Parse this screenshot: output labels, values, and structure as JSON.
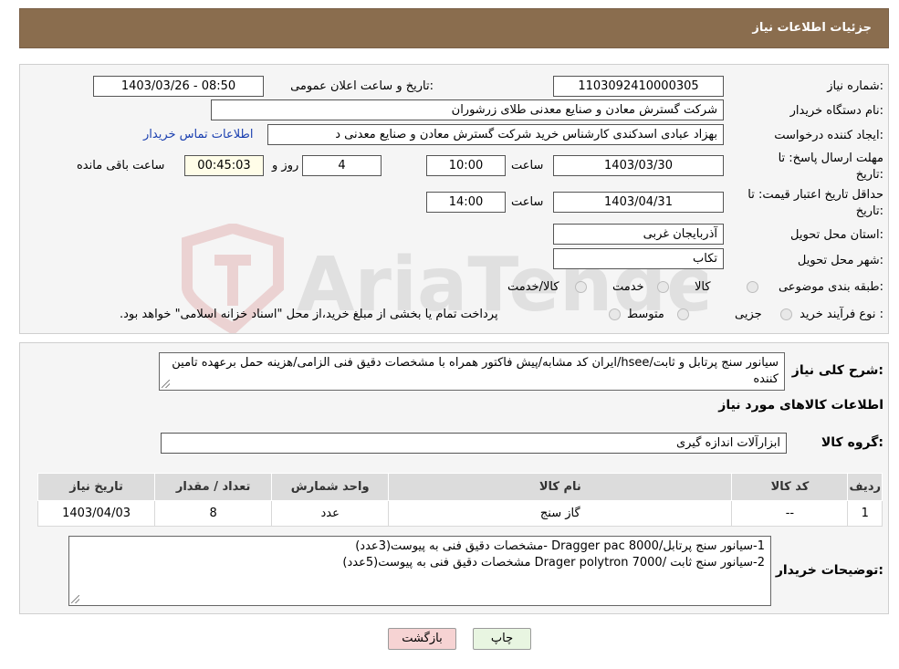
{
  "header": {
    "title": "جزئیات اطلاعات نیاز"
  },
  "form": {
    "need_number_label": "شماره نیاز:",
    "need_number": "1103092410000305",
    "announce_label": "تاریخ و ساعت اعلان عمومی:",
    "announce_value": "1403/03/26 - 08:50",
    "buyer_org_label": "نام دستگاه خریدار:",
    "buyer_org": "شرکت گسترش معادن و صنایع معدنی طلای زرشوران",
    "creator_label": "ایجاد کننده درخواست:",
    "creator": "بهزاد عبادی اسدکندی کارشناس خرید  شرکت گسترش معادن و صنایع معدنی د",
    "contact_link": "اطلاعات تماس خریدار",
    "reply_deadline_label_1": "مهلت ارسال پاسخ: تا",
    "reply_deadline_label_2": "تاریخ:",
    "reply_date": "1403/03/30",
    "time_label": "ساعت",
    "reply_time": "10:00",
    "days_value": "4",
    "days_label": "روز و",
    "remaining_time": "00:45:03",
    "remaining_label": "ساعت باقی مانده",
    "price_validity_label_1": "حداقل تاریخ اعتبار قیمت: تا",
    "price_validity_label_2": "تاریخ:",
    "price_date": "1403/04/31",
    "price_time": "14:00",
    "province_label": "استان محل تحویل:",
    "province": "آذربایجان غربی",
    "city_label": "شهر محل تحویل:",
    "city": "تکاب",
    "category_label": "طبقه بندی موضوعی:",
    "category_options": [
      "کالا",
      "خدمت",
      "کالا/خدمت"
    ],
    "process_label": "نوع فرآیند خرید :",
    "process_options": [
      "جزیی",
      "متوسط"
    ],
    "process_note": "پرداخت تمام یا بخشی از مبلغ خرید،از محل \"اسناد خزانه اسلامی\" خواهد بود."
  },
  "details": {
    "summary_label": "شرح کلی نیاز:",
    "summary_text": "سیانور سنج پرتابل و ثابت/hsee/ایران کد مشابه/پیش فاکتور همراه با مشخصات دقیق فنی الزامی/هزینه حمل برعهده تامین کننده",
    "goods_info_title": "اطلاعات کالاهای مورد نیاز",
    "goods_group_label": "گروه کالا:",
    "goods_group": "ابزارآلات اندازه گیری",
    "table": {
      "headers": [
        "ردیف",
        "کد کالا",
        "نام کالا",
        "واحد شمارش",
        "تعداد / مقدار",
        "تاریخ نیاز"
      ],
      "rows": [
        [
          "1",
          "--",
          "گاز سنج",
          "عدد",
          "8",
          "1403/04/03"
        ]
      ]
    },
    "buyer_notes_label": "توضیحات خریدار:",
    "buyer_notes_lines": [
      "1-سیانور سنج پرتابل/Dragger pac 8000 -مشخصات دقیق فنی به پیوست(3عدد)",
      "2-سیانور سنج ثابت /Drager polytron 7000 مشخصات دقیق فنی به پیوست(5عدد)"
    ]
  },
  "buttons": {
    "print": "چاپ",
    "back": "بازگشت"
  },
  "watermark": {
    "text": "AriaTender.neT"
  },
  "colors": {
    "header_bg": "#8a6d4e",
    "link": "#1a3fb0",
    "back_button_bg": "#f6d3d3",
    "print_button_bg": "#e8f5e1"
  }
}
